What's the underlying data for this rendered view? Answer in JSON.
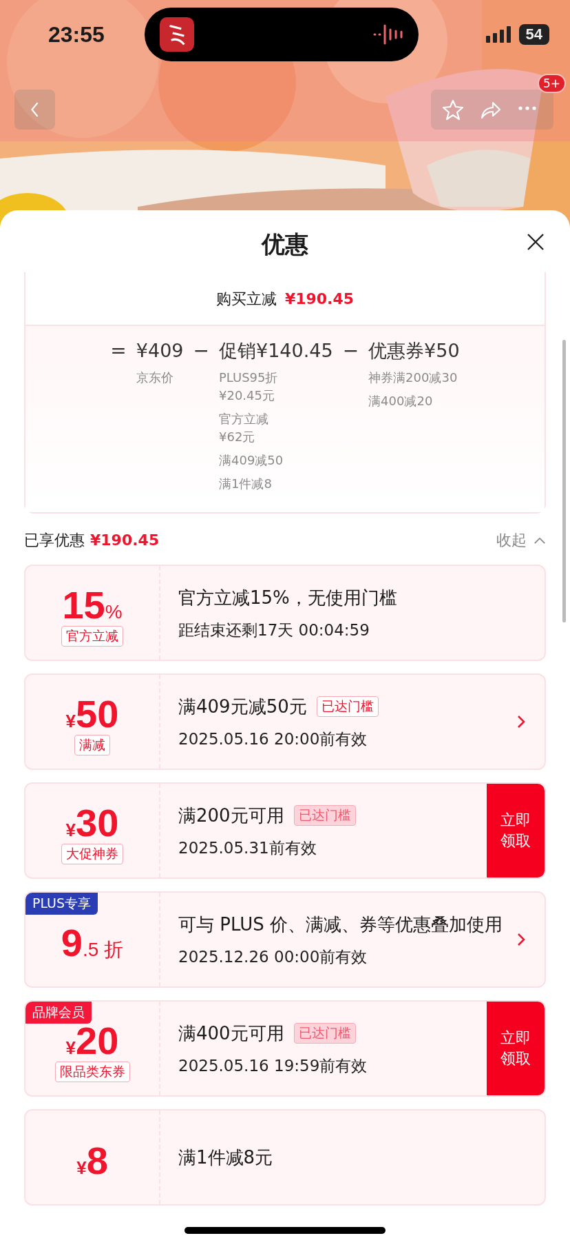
{
  "status_bar": {
    "time": "23:55",
    "battery": "54"
  },
  "nav": {
    "more_badge": "5+"
  },
  "sheet": {
    "title": "优惠"
  },
  "summary": {
    "label": "购买立减",
    "amount": "¥190.45"
  },
  "breakdown": {
    "equals": "=",
    "terms": [
      {
        "kind": "term",
        "amount": "¥409",
        "notes": [
          [
            "京东价"
          ]
        ]
      },
      {
        "kind": "operator",
        "symbol": "−"
      },
      {
        "kind": "term",
        "amount": "促销¥140.45",
        "notes": [
          [
            "PLUS95折",
            "¥20.45元"
          ],
          [
            "官方立减",
            "¥62元"
          ],
          [
            "满409减50"
          ],
          [
            "满1件减8"
          ]
        ]
      },
      {
        "kind": "operator",
        "symbol": "−"
      },
      {
        "kind": "term",
        "amount": "优惠券¥50",
        "notes": [
          [
            "神券满200减30"
          ],
          [
            "满400减20"
          ]
        ]
      }
    ]
  },
  "enjoyed": {
    "label": "已享优惠",
    "amount": "¥190.45",
    "toggle": "收起",
    "expanded": true
  },
  "coupons": [
    {
      "amount": "15",
      "suffix": "%",
      "label": "官方立减",
      "title": "官方立减15%，无使用门槛",
      "subtitle": "距结束还剩17天 00:04:59"
    },
    {
      "prefix": "¥",
      "amount": "50",
      "label": "满减",
      "title": "满409元减50元",
      "badge": {
        "text": "已达门槛",
        "filled": false
      },
      "subtitle": "2025.05.16 20:00前有效",
      "action": {
        "kind": "chevron"
      }
    },
    {
      "prefix": "¥",
      "amount": "30",
      "label": "大促神券",
      "title": "满200元可用",
      "badge": {
        "text": "已达门槛",
        "filled": true
      },
      "subtitle": "2025.05.31前有效",
      "action": {
        "kind": "button",
        "label": "立即领取"
      }
    },
    {
      "tag": {
        "text": "PLUS专享",
        "color": "#2a3db5"
      },
      "amount": "9",
      "suffix": ".5 折",
      "title": "可与 PLUS 价、满减、券等优惠叠加使用",
      "subtitle": "2025.12.26 00:00前有效",
      "action": {
        "kind": "chevron"
      }
    },
    {
      "tag": {
        "text": "品牌会员",
        "color": "#f5173a"
      },
      "prefix": "¥",
      "amount": "20",
      "label": "限品类东券",
      "title": "满400元可用",
      "badge": {
        "text": "已达门槛",
        "filled": true
      },
      "subtitle": "2025.05.16 19:59前有效",
      "action": {
        "kind": "button",
        "label": "立即领取"
      }
    },
    {
      "prefix": "¥",
      "amount": "8",
      "title": "满1件减8元"
    }
  ]
}
